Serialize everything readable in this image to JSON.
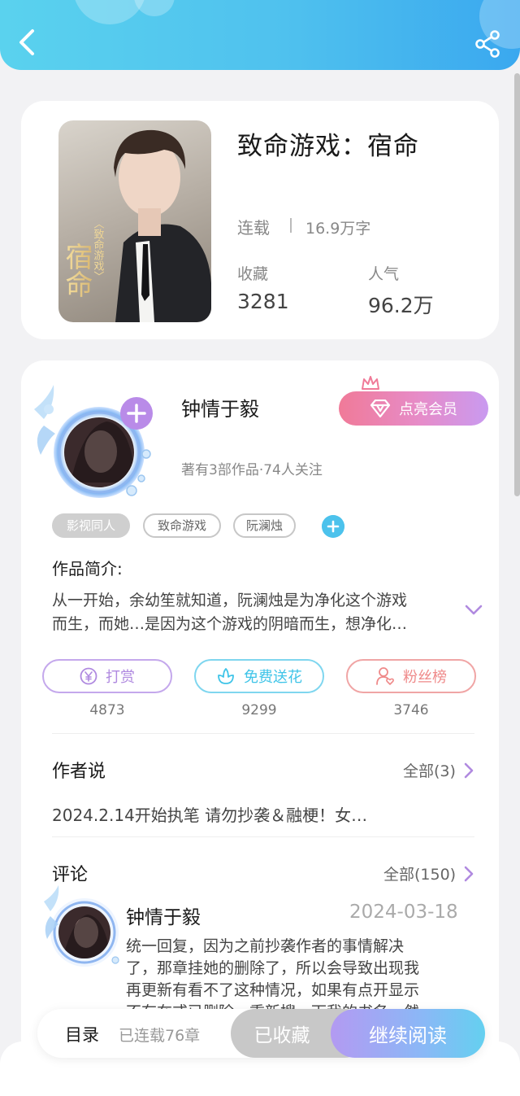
{
  "header": {
    "back_icon": "back-arrow-icon",
    "share_icon": "share-icon"
  },
  "book": {
    "title": "致命游戏：宿命",
    "status": "连载",
    "word_count": "16.9万字",
    "stats": [
      {
        "label": "收藏",
        "value": "3281"
      },
      {
        "label": "人气",
        "value": "96.2万"
      }
    ],
    "cover_text": {
      "title": "宿命",
      "subtitle": "〈致命游戏〉"
    }
  },
  "author": {
    "name": "钟情于毅",
    "vip_label": "点亮会员",
    "meta": "著有3部作品·74人关注",
    "tags": [
      "影视同人",
      "致命游戏",
      "阮澜烛"
    ]
  },
  "intro": {
    "label": "作品简介:",
    "lines": [
      "从一开始，余幼笙就知道，阮澜烛是为净化这个游戏",
      "而生，而她…是因为这个游戏的阴暗而生，想净化…"
    ]
  },
  "actions": [
    {
      "label": "打赏",
      "count": "4873",
      "color": "#b08ae0",
      "icon": "yuan-coin-icon"
    },
    {
      "label": "免费送花",
      "count": "9299",
      "color": "#3fc4e8",
      "icon": "flower-icon"
    },
    {
      "label": "粉丝榜",
      "count": "3746",
      "color": "#ef8a8a",
      "icon": "fan-user-icon"
    }
  ],
  "author_note": {
    "title": "作者说",
    "see_all": "全部(3)",
    "text": "2024.2.14开始执笔 请勿抄袭＆融梗！女…"
  },
  "comments": {
    "title": "评论",
    "see_all": "全部(150)",
    "items": [
      {
        "user": "钟情于毅",
        "date": "2024-03-18",
        "lines": [
          "统一回复，因为之前抄袭作者的事情解决",
          "了，那章挂她的删除了，所以会导致出现我",
          "再更新有看不了这种情况，如果有点开显示",
          "不存在或已删除，重新搜一下我的书名，然"
        ]
      }
    ]
  },
  "bottom_bar": {
    "toc_label": "目录",
    "toc_count": "已连载76章",
    "collected_label": "已收藏",
    "read_label": "继续阅读"
  },
  "colors": {
    "header_start": "#5ad2ee",
    "header_end": "#3aa8ef",
    "accent_purple": "#b08ae0",
    "accent_pink": "#f07a98"
  }
}
